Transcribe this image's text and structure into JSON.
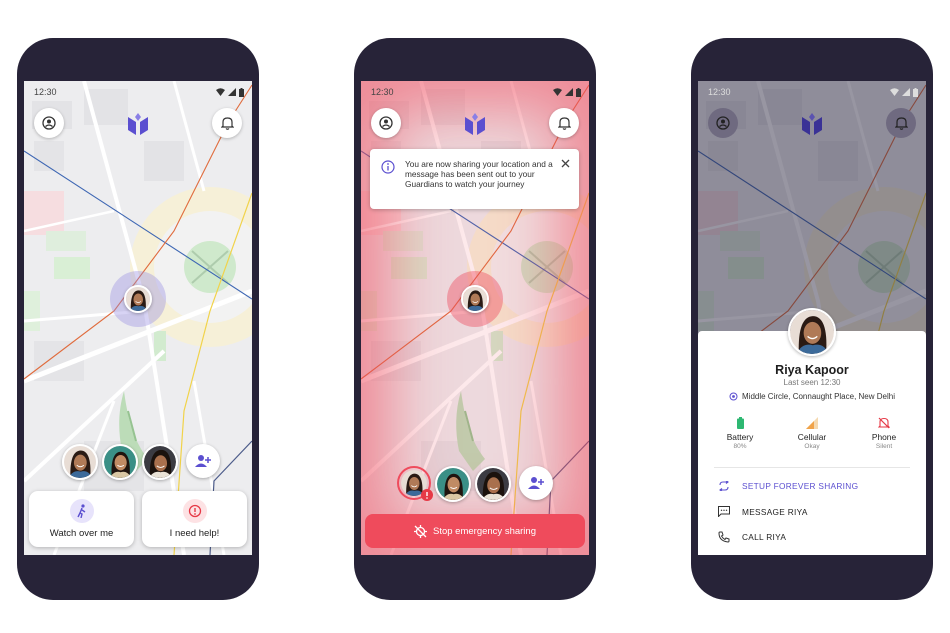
{
  "colors": {
    "phone_frame": "#272338",
    "accent_purple": "#5b4fd0",
    "emergency_red": "#ef4b5c",
    "danger_badge": "#e63946"
  },
  "phone1": {
    "status_time": "12:30",
    "icons": [
      "profile-icon",
      "app-logo-icon",
      "bell-icon",
      "walking-person-icon",
      "alert-icon",
      "add-person-icon"
    ],
    "watch_label": "Watch over me",
    "help_label": "I need help!"
  },
  "phone2": {
    "status_time": "12:30",
    "toast_text": "You are now sharing your location and a message has been sent out to your Guardians to watch your journey",
    "stop_label": "Stop emergency sharing"
  },
  "phone3": {
    "status_time": "12:30",
    "profile": {
      "name": "Riya Kapoor",
      "last_seen": "Last seen 12:30",
      "location": "Middle Circle, Connaught Place, New Delhi"
    },
    "stats": [
      {
        "label": "Battery",
        "value": "80%"
      },
      {
        "label": "Cellular",
        "value": "Okay"
      },
      {
        "label": "Phone",
        "value": "Silent"
      }
    ],
    "actions": {
      "forever": "SETUP FOREVER SHARING",
      "message": "MESSAGE RIYA",
      "call": "CALL RIYA"
    }
  }
}
